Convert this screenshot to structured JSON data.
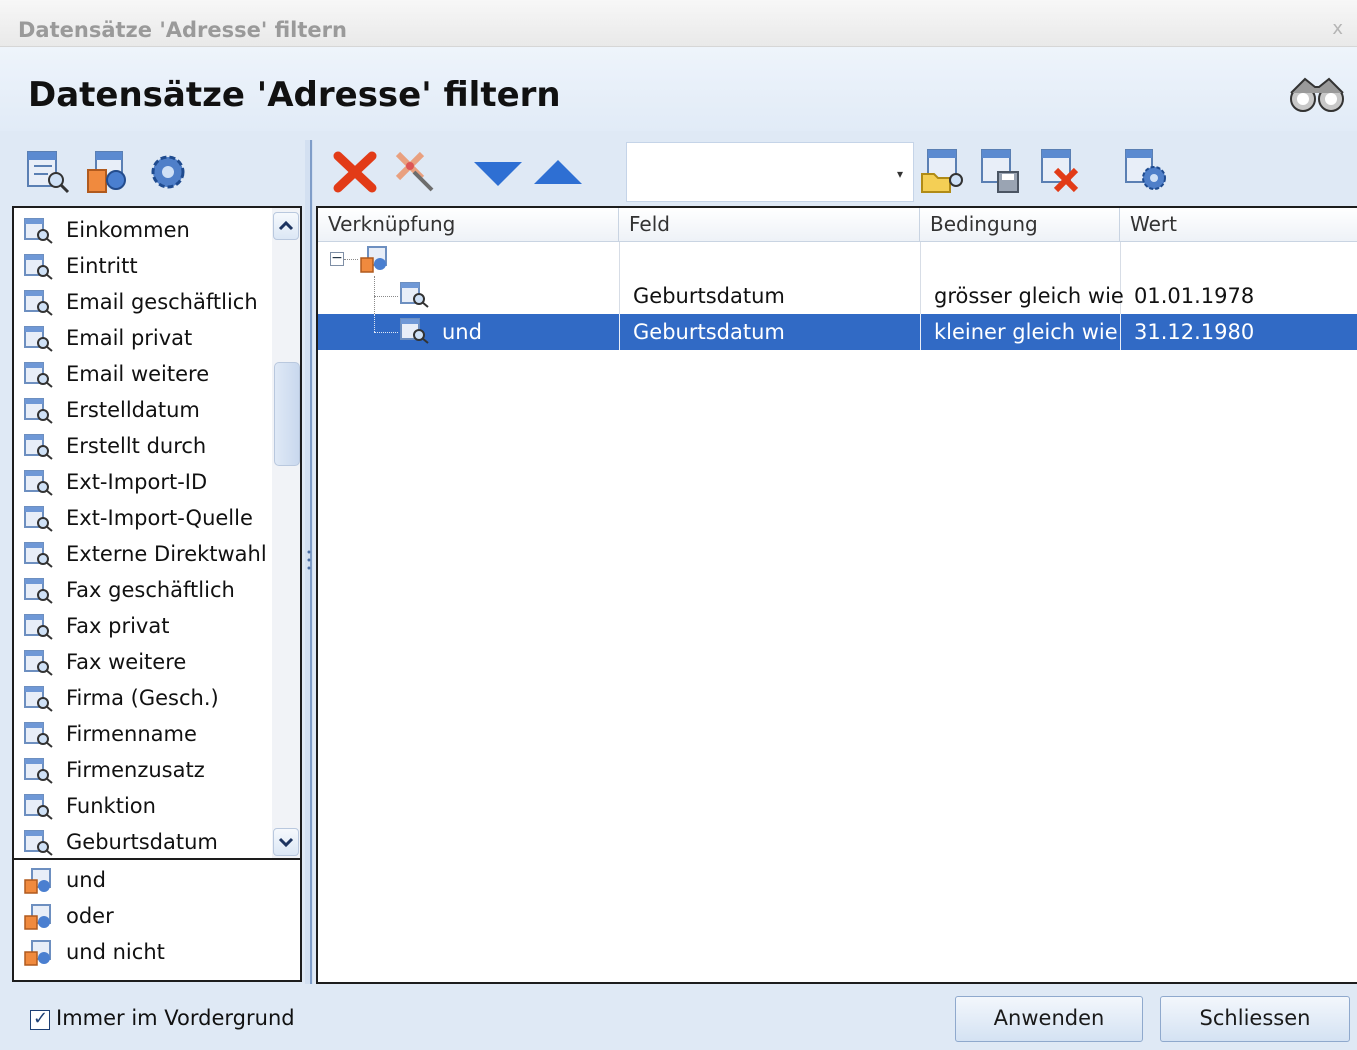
{
  "window": {
    "title": "Datensätze 'Adresse' filtern",
    "close_glyph": "x"
  },
  "header": {
    "title": "Datensätze 'Adresse' filtern",
    "icon": "binoculars-icon"
  },
  "left_toolbar": {
    "icons": [
      "field-search-icon",
      "field-add-icon",
      "settings-gear-icon"
    ]
  },
  "fields": {
    "items": [
      "Einkommen",
      "Eintritt",
      "Email geschäftlich",
      "Email privat",
      "Email weitere",
      "Erstelldatum",
      "Erstellt durch",
      "Ext-Import-ID",
      "Ext-Import-Quelle",
      "Externe Direktwahl",
      "Fax geschäftlich",
      "Fax privat",
      "Fax weitere",
      "Firma (Gesch.)",
      "Firmenname",
      "Firmenzusatz",
      "Funktion",
      "Geburtsdatum"
    ]
  },
  "operators": {
    "items": [
      "und",
      "oder",
      "und nicht"
    ]
  },
  "right_toolbar": {
    "icons": [
      "delete-red-x-icon",
      "delete-all-icon",
      "move-down-icon",
      "move-up-icon",
      "open-filter-icon",
      "save-filter-icon",
      "delete-filter-icon",
      "filter-settings-icon"
    ],
    "combo_value": ""
  },
  "grid": {
    "columns": [
      "Verknüpfung",
      "Feld",
      "Bedingung",
      "Wert"
    ],
    "rows": [
      {
        "link": "",
        "field": "Geburtsdatum",
        "condition": "grösser gleich wie",
        "value": "01.01.1978"
      },
      {
        "link": "und",
        "field": "Geburtsdatum",
        "condition": "kleiner gleich wie",
        "value": "31.12.1980"
      }
    ],
    "selected_row": 1
  },
  "footer": {
    "always_on_top_label": "Immer im Vordergrund",
    "always_on_top_checked": true,
    "apply_label": "Anwenden",
    "close_label": "Schliessen"
  },
  "colors": {
    "selection": "#316ac5",
    "background": "#dfe9f5"
  }
}
